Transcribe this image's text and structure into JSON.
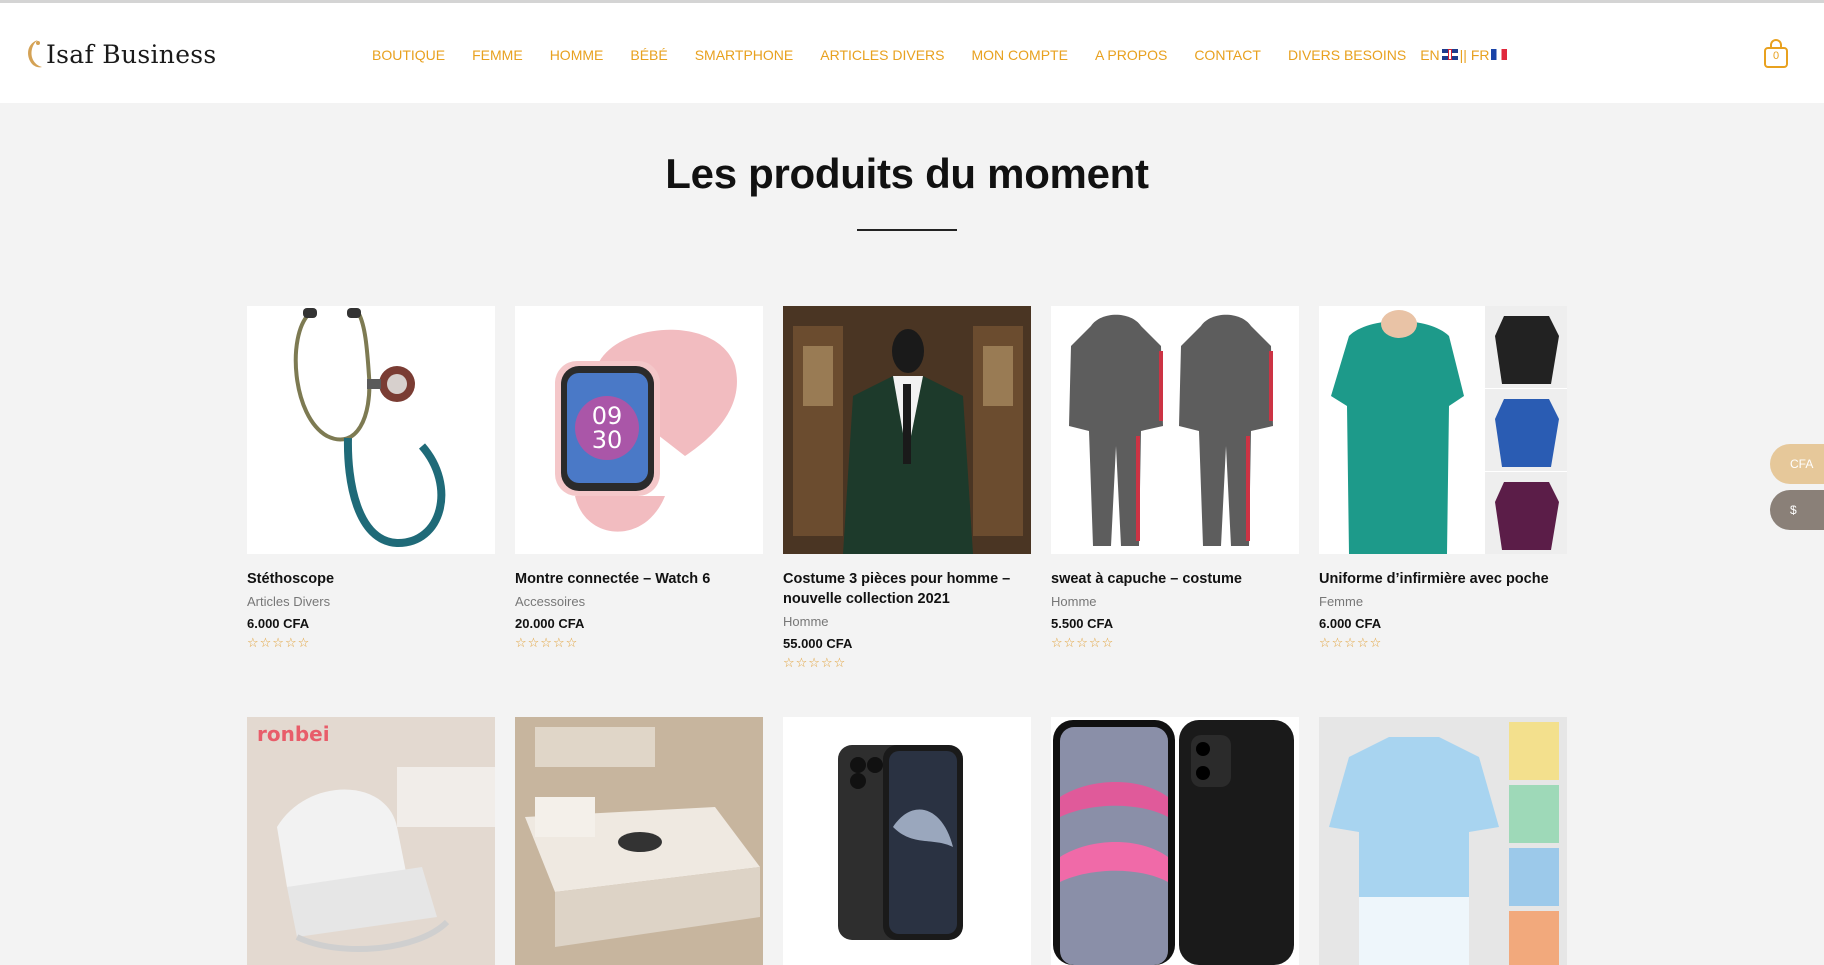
{
  "brand": {
    "name": "Isaf Business"
  },
  "nav": {
    "items": [
      "BOUTIQUE",
      "FEMME",
      "HOMME",
      "BÉBÉ",
      "SMARTPHONE",
      "ARTICLES DIVERS",
      "MON COMPTE",
      "A PROPOS",
      "CONTACT",
      "DIVERS BESOINS"
    ],
    "lang_en": "EN",
    "lang_sep": "|| FR"
  },
  "cart": {
    "count": "0"
  },
  "section": {
    "title": "Les produits du moment"
  },
  "products": [
    {
      "name": "Stéthoscope",
      "category": "Articles Divers",
      "price": "6.000 CFA",
      "rating": 0
    },
    {
      "name": "Montre connectée – Watch 6",
      "category": "Accessoires",
      "price": "20.000 CFA",
      "rating": 0
    },
    {
      "name": "Costume 3 pièces pour homme – nouvelle collection 2021",
      "category": "Homme",
      "price": "55.000 CFA",
      "rating": 0
    },
    {
      "name": "sweat à capuche – costume",
      "category": "Homme",
      "price": "5.500 CFA",
      "rating": 0
    },
    {
      "name": "Uniforme d’infirmière avec poche",
      "category": "Femme",
      "price": "6.000 CFA",
      "rating": 0
    }
  ],
  "product_images_row2": [
    {
      "brand_text": "ronbei"
    },
    {},
    {},
    {},
    {}
  ],
  "currency": {
    "cfa": "CFA",
    "usd": "$"
  },
  "colors": {
    "accent": "#e8a11f",
    "background": "#f3f3f3"
  },
  "icons": {
    "cart": "shopping-bag-icon",
    "star": "star-outline-icon"
  }
}
